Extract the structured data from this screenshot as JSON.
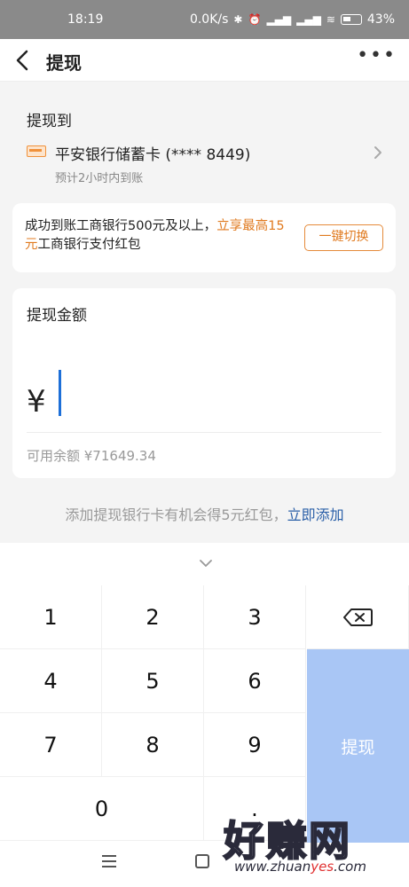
{
  "status_bar": {
    "time": "18:19",
    "network_speed": "0.0K/s",
    "signal1": "HD",
    "signal2": "HD",
    "battery": "43%"
  },
  "header": {
    "title": "提现",
    "more": "•••"
  },
  "withdraw_to": {
    "label": "提现到",
    "bank_name": "平安银行储蓄卡 (**** 8449)",
    "eta": "预计2小时内到账"
  },
  "promo": {
    "text_before": "成功到账工商银行500元及以上，",
    "text_highlight": "立享最高15元",
    "text_after": "工商银行支付红包",
    "button_label": "一键切换"
  },
  "amount": {
    "label": "提现金额",
    "currency": "¥",
    "value": "",
    "available": "可用余额 ¥71649.34"
  },
  "add_card_tip": {
    "text": "添加提现银行卡有机会得5元红包，",
    "link": "立即添加"
  },
  "keypad": {
    "keys": [
      "1",
      "2",
      "3",
      "4",
      "5",
      "6",
      "7",
      "8",
      "9",
      "0",
      "."
    ],
    "submit_label": "提现"
  },
  "watermark": {
    "big": "好赚网",
    "small_prefix": "www.zhuan",
    "small_highlight": "yes",
    "small_suffix": ".com"
  },
  "colors": {
    "accent_orange": "#e07a1f",
    "submit_blue": "#a9c6f5",
    "link_blue": "#2a5fa8",
    "cursor_blue": "#1d6fd8"
  }
}
